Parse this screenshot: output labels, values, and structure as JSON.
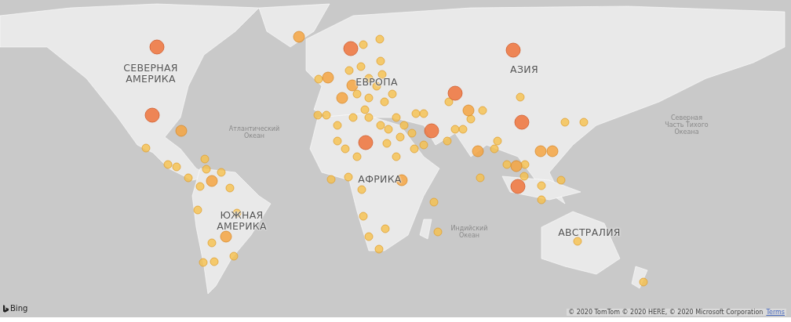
{
  "map": {
    "labels": [
      {
        "kind": "continent",
        "text": "СЕВЕРНАЯ АМЕРИКА"
      },
      {
        "kind": "continent",
        "text": "ЕВРОПА"
      },
      {
        "kind": "continent",
        "text": "АЗИЯ"
      },
      {
        "kind": "continent",
        "text": "АФРИКА"
      },
      {
        "kind": "continent",
        "text": "ЮЖНАЯ АМЕРИКА"
      },
      {
        "kind": "continent",
        "text": "АВСТРАЛИЯ"
      },
      {
        "kind": "ocean",
        "text": "Атлантический Океан"
      },
      {
        "kind": "ocean",
        "text": "Северная Часть Тихого Океана"
      },
      {
        "kind": "ocean",
        "text": "Индийский Океан"
      }
    ],
    "logo": "Bing",
    "copyright": "© 2020 TomTom © 2020 HERE, © 2020 Microsoft Corporation",
    "terms_link": "Terms"
  }
}
